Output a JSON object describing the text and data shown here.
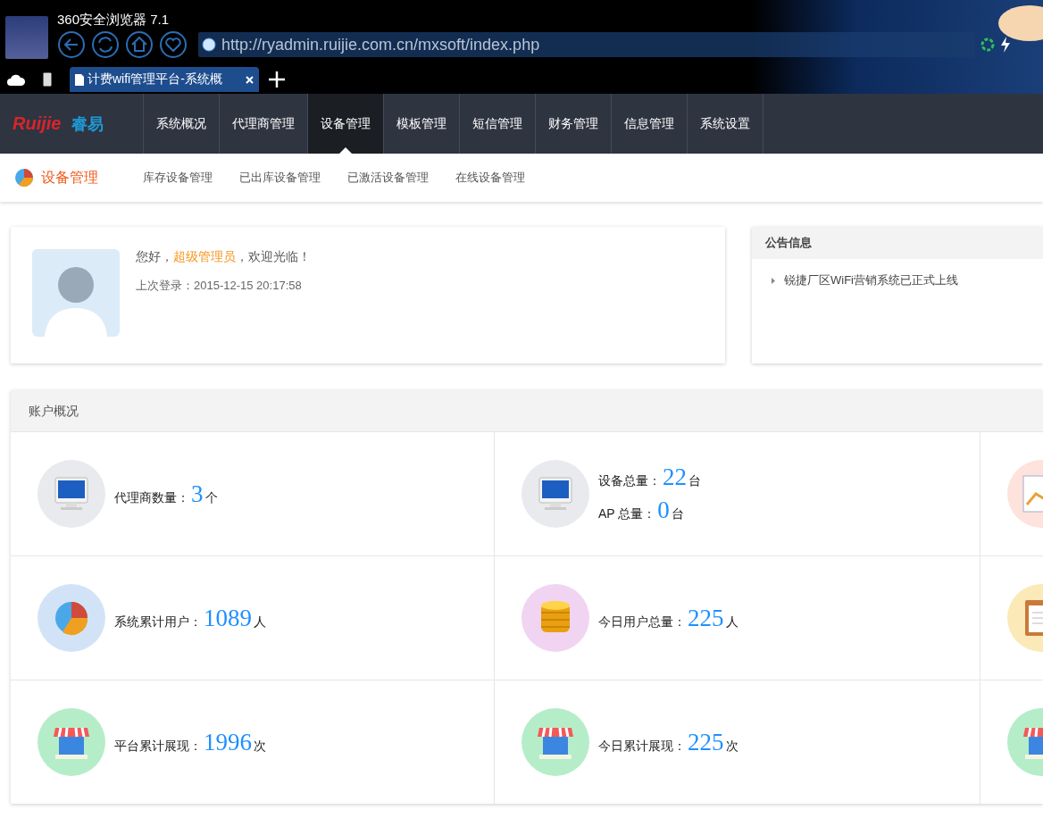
{
  "browser": {
    "title": "360安全浏览器 7.1",
    "url": "http://ryadmin.ruijie.com.cn/mxsoft/index.php",
    "tabs": [
      {
        "label": "计费wifi管理平台-系统概",
        "selected": true
      }
    ]
  },
  "brand": {
    "logo": "Ruijie",
    "name": "睿易"
  },
  "nav": [
    {
      "label": "系统概况",
      "selected": false
    },
    {
      "label": "代理商管理",
      "selected": false
    },
    {
      "label": "设备管理",
      "selected": true
    },
    {
      "label": "模板管理",
      "selected": false
    },
    {
      "label": "短信管理",
      "selected": false
    },
    {
      "label": "财务管理",
      "selected": false
    },
    {
      "label": "信息管理",
      "selected": false
    },
    {
      "label": "系统设置",
      "selected": false
    }
  ],
  "subnav": {
    "title": "设备管理",
    "links": [
      "库存设备管理",
      "已出库设备管理",
      "已激活设备管理",
      "在线设备管理"
    ]
  },
  "welcome": {
    "greeting_before": "您好，",
    "user": "超级管理员",
    "greeting_after": "，欢迎光临！",
    "last_login": "上次登录：2015-12-15 20:17:58"
  },
  "notice": {
    "title": "公告信息",
    "items": [
      "锐捷厂区WiFi营销系统已正式上线"
    ]
  },
  "account": {
    "title": "账户概况",
    "rows": [
      {
        "cells": [
          {
            "kind": "monitor",
            "lines": [
              {
                "label": "代理商数量：",
                "value": "3",
                "unit": "个"
              }
            ]
          },
          {
            "kind": "monitor",
            "lines": [
              {
                "label": "设备总量：",
                "value": "22",
                "unit": "台"
              },
              {
                "label": "AP 总量：",
                "value": "0",
                "unit": "台"
              }
            ]
          },
          {
            "kind": "chart"
          }
        ]
      },
      {
        "cells": [
          {
            "kind": "pie",
            "lines": [
              {
                "label": "系统累计用户：",
                "value": "1089",
                "unit": "人"
              }
            ]
          },
          {
            "kind": "coins",
            "lines": [
              {
                "label": "今日用户总量：",
                "value": "225",
                "unit": "人"
              }
            ]
          },
          {
            "kind": "notepad"
          }
        ]
      },
      {
        "cells": [
          {
            "kind": "shop",
            "lines": [
              {
                "label": "平台累计展现：",
                "value": "1996",
                "unit": "次"
              }
            ]
          },
          {
            "kind": "shop",
            "lines": [
              {
                "label": "今日累计展现：",
                "value": "225",
                "unit": "次"
              }
            ]
          },
          {
            "kind": "shop"
          }
        ]
      }
    ]
  }
}
